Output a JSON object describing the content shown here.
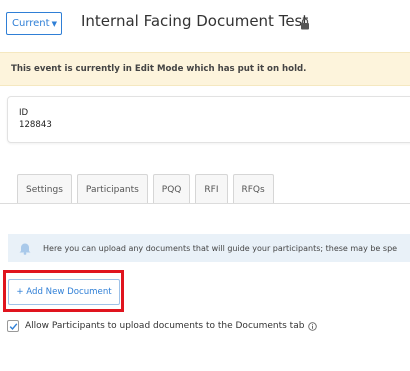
{
  "header": {
    "version_select": {
      "value": "Current",
      "icon": "caret-down-icon"
    },
    "title": "Internal Facing Document Test",
    "lock_icon": "lock-icon"
  },
  "banner": {
    "text": "This event is currently in Edit Mode which has put it on hold.",
    "background": "#fdf4dc"
  },
  "event_info": {
    "id_label": "ID",
    "id_value": "128843"
  },
  "tabs": [
    {
      "label": "Settings"
    },
    {
      "label": "Participants"
    },
    {
      "label": "PQQ"
    },
    {
      "label": "RFI"
    },
    {
      "label": "RFQs"
    }
  ],
  "documents": {
    "info_text": "Here you can upload any documents that will guide your participants; these may be spe",
    "info_icon": "bell-icon",
    "add_button_label": "+ Add New Document",
    "allow_upload": {
      "checked": true,
      "label": "Allow Participants to upload documents to the Documents tab",
      "icon": "info-circle-icon"
    }
  },
  "colors": {
    "accent": "#2f7fd6",
    "highlight": "#e0141e",
    "info_background": "#e9f1f8"
  }
}
